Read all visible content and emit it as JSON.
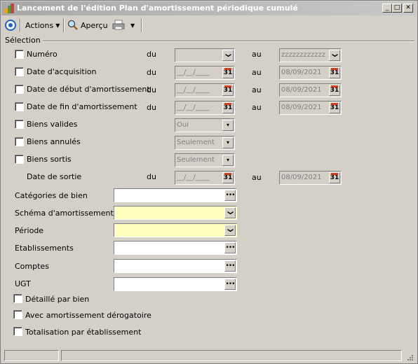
{
  "window": {
    "title": "Lancement de l'édition Plan d'amortissement périodique cumulé",
    "minimize": "_",
    "maximize": "□",
    "close": "✕"
  },
  "toolbar": {
    "actions_label": "Actions",
    "apercu_label": "Aperçu"
  },
  "selection": {
    "group_label": "Sélection",
    "du": "du",
    "au": "au",
    "rows": [
      {
        "label": "Numéro",
        "from": "",
        "to": "zzzzzzzzzzzz"
      },
      {
        "label": "Date d'acquisition",
        "from": "__/__/____",
        "to": "08/09/2021"
      },
      {
        "label": "Date de début d'amortissement",
        "from": "__/__/____",
        "to": "08/09/2021"
      },
      {
        "label": "Date de fin d'amortissement",
        "from": "__/__/____",
        "to": "08/09/2021"
      }
    ],
    "biens_valides": {
      "label": "Biens valides",
      "value": "Oui"
    },
    "biens_annules": {
      "label": "Biens annulés",
      "value": "Seulement"
    },
    "biens_sortis": {
      "label": "Biens sortis",
      "value": "Seulement"
    },
    "date_sortie": {
      "label": "Date de sortie",
      "from": "__/__/____",
      "to": "08/09/2021"
    }
  },
  "fields": {
    "categories": {
      "label": "Catégories de bien",
      "value": ""
    },
    "schema": {
      "label": "Schéma d'amortissement",
      "value": ""
    },
    "periode": {
      "label": "Période",
      "value": ""
    },
    "etablissements": {
      "label": "Etablissements",
      "value": ""
    },
    "comptes": {
      "label": "Comptes",
      "value": ""
    },
    "ugt": {
      "label": "UGT",
      "value": ""
    }
  },
  "options": {
    "detail": "Détaillé par bien",
    "derogatoire": "Avec amortissement dérogatoire",
    "totalisation": "Totalisation par établissement"
  },
  "icons": {
    "calendar_text": "31",
    "dots_text": "•••",
    "chevron": "❯",
    "dropdown": "▼",
    "small_dropdown": "▾"
  },
  "colors": {
    "mandatory_bg": "#ffffc0",
    "window_bg": "#d4d0c8",
    "titlebar": "#a8a8a8"
  }
}
